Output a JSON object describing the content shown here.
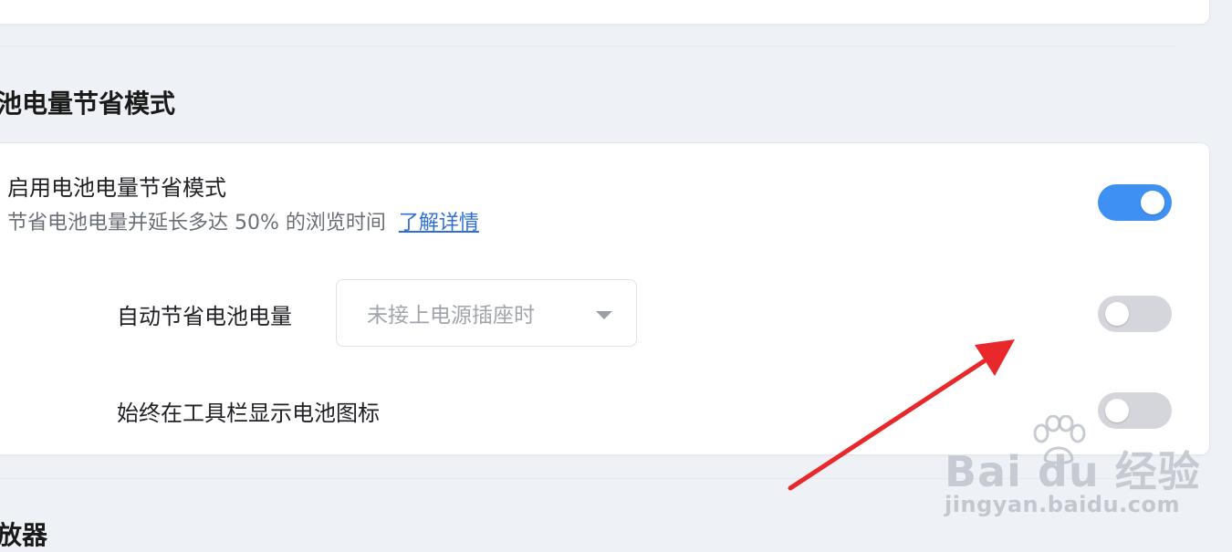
{
  "battery_section": {
    "title": "池电量节省模式",
    "enable_saver": {
      "title": "启用电池电量节省模式",
      "description": "节省电池电量并延长多达 50% 的浏览时间",
      "learn_more": "了解详情",
      "enabled": true
    },
    "auto_save": {
      "label": "自动节省电池电量",
      "dropdown_value": "未接上电源插座时",
      "enabled": false
    },
    "toolbar_icon": {
      "label": "始终在工具栏显示电池图标",
      "enabled": false
    }
  },
  "next_section": {
    "title": "放器"
  },
  "watermark": {
    "logo": "Bai du 经验",
    "url": "jingyan.baidu.com"
  },
  "colors": {
    "accent": "#3e91f3",
    "toggle_off": "#d5d6dc",
    "annotation_arrow": "#e8282b",
    "page_background": "#eef1f6"
  }
}
